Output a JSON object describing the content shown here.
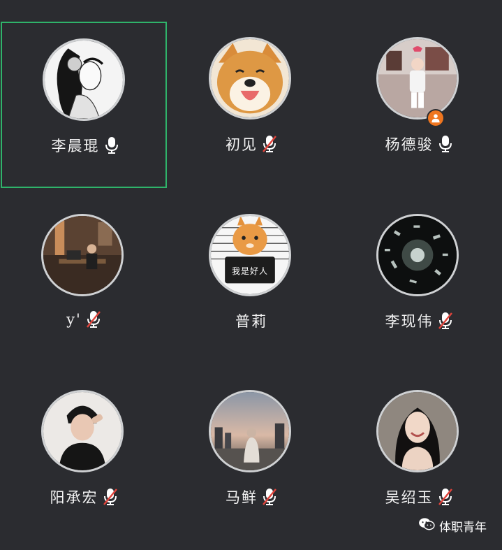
{
  "participants": [
    {
      "name": "李晨琨",
      "muted": false,
      "host": false,
      "active": true,
      "avatar": "ink-portrait-woman"
    },
    {
      "name": "初见",
      "muted": true,
      "host": false,
      "active": false,
      "avatar": "shiba-dog"
    },
    {
      "name": "杨德骏",
      "muted": false,
      "host": true,
      "active": false,
      "avatar": "room-scene"
    },
    {
      "name": "y'",
      "muted": true,
      "host": false,
      "active": false,
      "avatar": "dark-room-desk"
    },
    {
      "name": "普莉",
      "muted": false,
      "host": false,
      "active": false,
      "avatar": "orange-cat-sign"
    },
    {
      "name": "李现伟",
      "muted": true,
      "host": false,
      "active": false,
      "avatar": "paper-explosion"
    },
    {
      "name": "阳承宏",
      "muted": true,
      "host": false,
      "active": false,
      "avatar": "young-man"
    },
    {
      "name": "马鲜",
      "muted": true,
      "host": false,
      "active": false,
      "avatar": "dusk-skyline"
    },
    {
      "name": "吴绍玉",
      "muted": true,
      "host": false,
      "active": false,
      "avatar": "smiling-woman"
    }
  ],
  "sign_text": "我是好人",
  "watermark": {
    "label": "体职青年",
    "icon": "wechat-official-account-icon"
  },
  "colors": {
    "background": "#2b2c30",
    "active_border": "#2fb36a",
    "host_badge": "#f0761f",
    "mute_slash": "#e0443c"
  }
}
